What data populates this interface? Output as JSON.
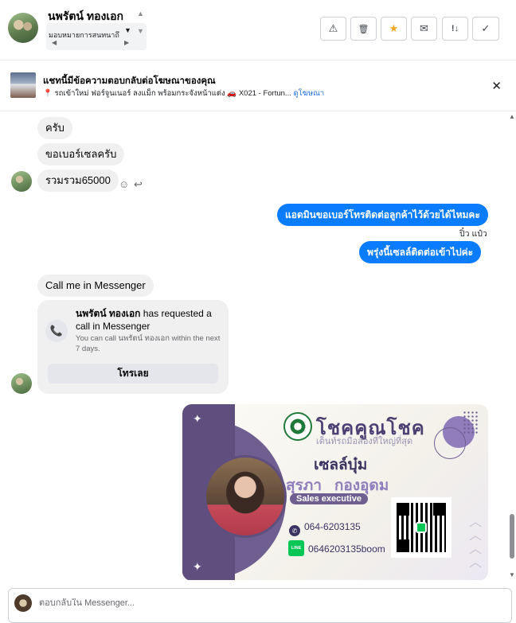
{
  "header": {
    "contact_name": "นพรัตน์ ทองเอก",
    "assign_label": "มอบหมายการสนทนาถึ",
    "actions": [
      {
        "name": "spam-button",
        "icon": "⚠"
      },
      {
        "name": "delete-button",
        "icon": "🗑"
      },
      {
        "name": "star-button",
        "icon": "★"
      },
      {
        "name": "mark-unread-button",
        "icon": "✉"
      },
      {
        "name": "follow-up-button",
        "icon": "!↓"
      },
      {
        "name": "mark-done-button",
        "icon": "✓"
      }
    ]
  },
  "ad_banner": {
    "title": "แชทนี้มีข้อความตอบกลับต่อโฆษณาของคุณ",
    "detail": "📍 รถเข้าใหม่ ฟอร์จูนเนอร์ ลงแม็ก พร้อมกระจังหน้าแต่ง 🚗 X021 - Fortun...",
    "link": "ดูโฆษณา",
    "close_icon": "✕"
  },
  "messages": {
    "m1": "ครับ",
    "m2": "ขอเบอร์เซลครับ",
    "m3": "รวมรวม65000",
    "m4": "แอดมินขอเบอร์โทรติดต่อลูกค้าไว้ด้วยได้ไหมคะ",
    "m4_sender": "ปิ๋ว แป๋ว",
    "m5": "พรุ่งนี้เซลล์ติดต่อเข้าไปค่ะ",
    "m6": "Call me in Messenger",
    "call_card": {
      "requester": "นพรัตน์ ทองเอก",
      "request_text": "has requested a call in Messenger",
      "sub": "You can call นพรัตน์ ทองเอก within the next 7 days.",
      "button": "โทรเลย"
    }
  },
  "business_card": {
    "brand": "โชคคูณโชค",
    "slogan": "เต็นท์รถมือสองที่ใหญ่ที่สุด",
    "nickname": "เซลล์บุ๋ม",
    "name": "สุรภา   กองอุดม",
    "role": "Sales executive",
    "phone": "064-6203135",
    "line_label": "LINE",
    "line_id": "0646203135boom"
  },
  "composer": {
    "placeholder": "ตอบกลับใน Messenger..."
  },
  "colors": {
    "outgoing_bubble": "#0a7cff",
    "incoming_bubble": "#f0f0f0",
    "card_purple": "#5e4f7e"
  }
}
